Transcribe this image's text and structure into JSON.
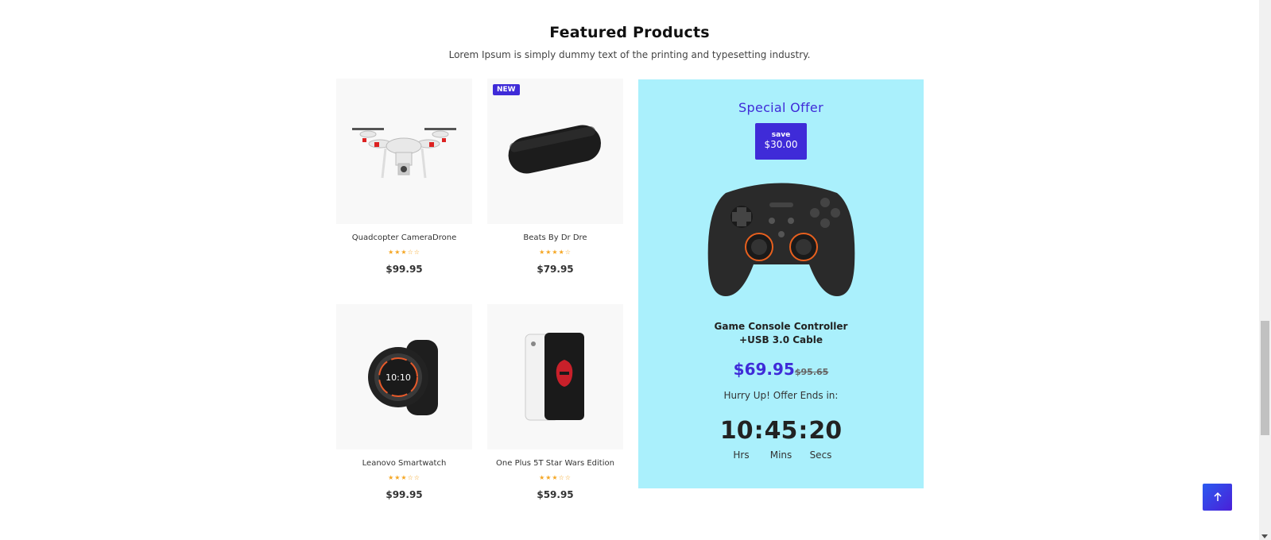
{
  "section": {
    "title": "Featured Products",
    "subtitle": "Lorem Ipsum is simply dummy text of the printing and typesetting industry."
  },
  "products": [
    {
      "name": "Quadcopter CameraDrone",
      "rating": 3,
      "stars": "★★★☆☆",
      "price": "$99.95",
      "badge": ""
    },
    {
      "name": "Beats By Dr Dre",
      "rating": 4,
      "stars": "★★★★☆",
      "price": "$79.95",
      "badge": "NEW"
    },
    {
      "name": "Leanovo Smartwatch",
      "rating": 3,
      "stars": "★★★☆☆",
      "price": "$99.95",
      "badge": ""
    },
    {
      "name": "One Plus 5T Star Wars Edition",
      "rating": 3,
      "stars": "★★★☆☆",
      "price": "$59.95",
      "badge": ""
    }
  ],
  "offer": {
    "title": "Special Offer",
    "save_label": "save",
    "save_amount": "$30.00",
    "product_line1": "Game Console Controller",
    "product_line2": "+USB 3.0 Cable",
    "price_now": "$69.95",
    "price_old": "$95.65",
    "hurry": "Hurry Up! Offer Ends in:",
    "timer": {
      "hrs": "10",
      "mins": "45",
      "secs": "20",
      "sep": ":"
    },
    "timer_labels": {
      "hrs": "Hrs",
      "mins": "Mins",
      "secs": "Secs"
    }
  },
  "back_to_top_icon": "arrow-up-icon",
  "colors": {
    "accent": "#3f2bd8",
    "offer_bg": "#aaf0fc",
    "star": "#f5a623"
  }
}
